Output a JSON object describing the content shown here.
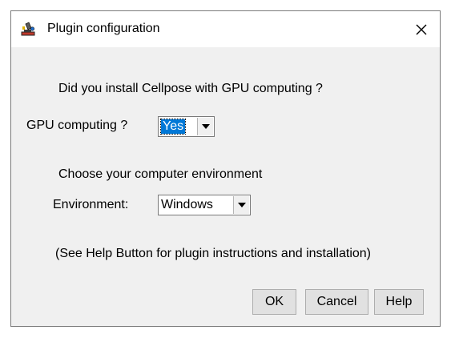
{
  "window": {
    "title": "Plugin configuration",
    "app_icon": "imagej-microscope-icon",
    "close_icon": "close-icon"
  },
  "form": {
    "question": "Did you install Cellpose with GPU computing ?",
    "gpu_label": "GPU computing ?",
    "gpu_value": "Yes",
    "env_prompt": "Choose your computer environment",
    "env_label": "Environment:",
    "env_value": "Windows",
    "help_note": "(See Help Button for plugin instructions and installation)"
  },
  "buttons": {
    "ok": "OK",
    "cancel": "Cancel",
    "help": "Help"
  },
  "colors": {
    "selection": "#0078d7",
    "dialog_bg": "#f0f0f0",
    "button_bg": "#e1e1e1"
  }
}
